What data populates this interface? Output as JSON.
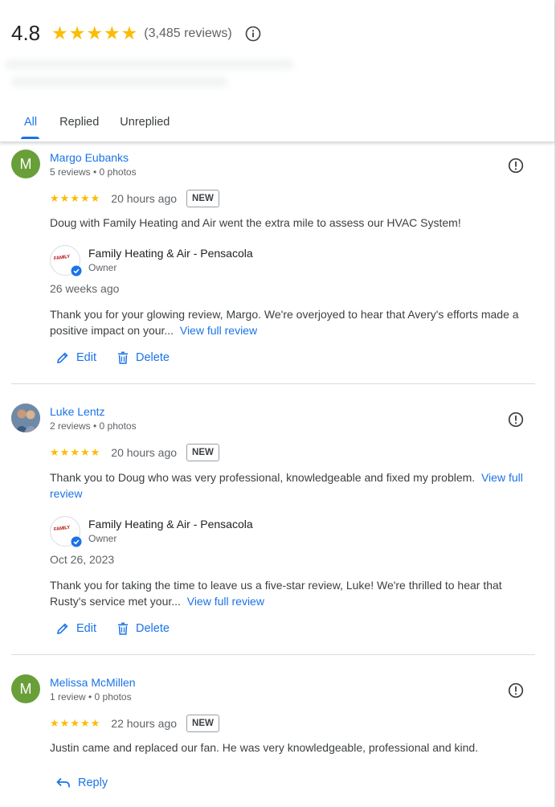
{
  "summary": {
    "rating": "4.8",
    "stars": 5,
    "review_count": "(3,485 reviews)"
  },
  "tabs": [
    {
      "label": "All",
      "active": true
    },
    {
      "label": "Replied",
      "active": false
    },
    {
      "label": "Unreplied",
      "active": false
    }
  ],
  "reviews": [
    {
      "avatar_letter": "M",
      "name": "Margo Eubanks",
      "meta": "5 reviews • 0 photos",
      "stars": 5,
      "time": "20 hours ago",
      "badge": "NEW",
      "text": "Doug with Family Heating and Air went the extra mile to assess our HVAC System!",
      "owner_name": "Family Heating & Air - Pensacola",
      "owner_role": "Owner",
      "reply_date": "26 weeks ago",
      "reply_text": "Thank you for your glowing review, Margo. We're overjoyed to hear that Avery's efforts made a positive impact on your...",
      "reply_link": "View full review",
      "edit_label": "Edit",
      "delete_label": "Delete"
    },
    {
      "avatar_letter": "",
      "name": "Luke Lentz",
      "meta": "2 reviews • 0 photos",
      "stars": 5,
      "time": "20 hours ago",
      "badge": "NEW",
      "text": "Thank you to Doug who was very professional, knowledgeable and fixed my problem.",
      "text_link": "View full review",
      "owner_name": "Family Heating & Air - Pensacola",
      "owner_role": "Owner",
      "reply_date": "Oct 26, 2023",
      "reply_text": "Thank you for taking the time to leave us a five-star review, Luke! We're thrilled to hear that Rusty's service met your...",
      "reply_link": "View full review",
      "edit_label": "Edit",
      "delete_label": "Delete"
    },
    {
      "avatar_letter": "M",
      "name": "Melissa McMillen",
      "meta": "1 review • 0 photos",
      "stars": 5,
      "time": "22 hours ago",
      "badge": "NEW",
      "text": "Justin came and replaced our fan. He was very knowledgeable, professional and kind.",
      "reply_label": "Reply"
    }
  ],
  "owner_logo_text": "FAMILY",
  "colors": {
    "accent": "#1a73e8",
    "star": "#fbbc04",
    "avatar_green": "#689f38"
  }
}
